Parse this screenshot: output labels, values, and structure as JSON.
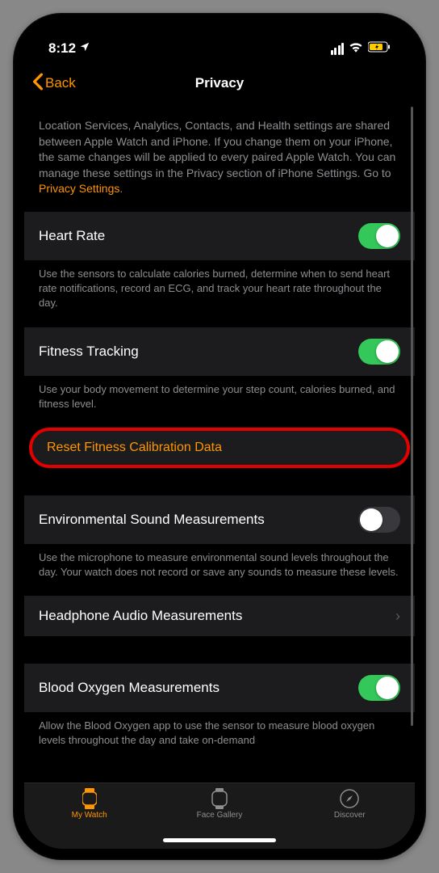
{
  "status": {
    "time": "8:12"
  },
  "nav": {
    "back": "Back",
    "title": "Privacy"
  },
  "intro": {
    "text": "Location Services, Analytics, Contacts, and Health settings are shared between Apple Watch and iPhone. If you change them on your iPhone, the same changes will be applied to every paired Apple Watch. You can manage these settings in the Privacy section of iPhone Settings. Go to ",
    "link": "Privacy Settings"
  },
  "rows": {
    "heart_rate": {
      "label": "Heart Rate",
      "footer": "Use the sensors to calculate calories burned, determine when to send heart rate notifications, record an ECG, and track your heart rate throughout the day.",
      "enabled": true
    },
    "fitness_tracking": {
      "label": "Fitness Tracking",
      "footer": "Use your body movement to determine your step count, calories burned, and fitness level.",
      "enabled": true
    },
    "reset_calibration": {
      "label": "Reset Fitness Calibration Data"
    },
    "env_sound": {
      "label": "Environmental Sound Measurements",
      "footer": "Use the microphone to measure environmental sound levels throughout the day. Your watch does not record or save any sounds to measure these levels.",
      "enabled": false
    },
    "headphone_audio": {
      "label": "Headphone Audio Measurements"
    },
    "blood_oxygen": {
      "label": "Blood Oxygen Measurements",
      "footer": "Allow the Blood Oxygen app to use the sensor to measure blood oxygen levels throughout the day and take on-demand",
      "enabled": true
    }
  },
  "tabs": {
    "my_watch": "My Watch",
    "face_gallery": "Face Gallery",
    "discover": "Discover"
  }
}
